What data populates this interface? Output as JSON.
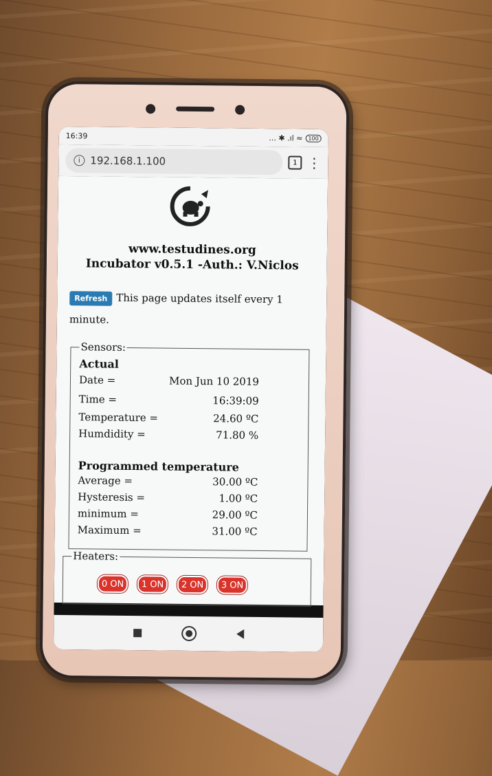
{
  "status_bar": {
    "time": "16:39",
    "signal": "... ✱ .ıl ≈",
    "battery": "100"
  },
  "browser": {
    "url": "192.168.1.100",
    "tab_count": "1",
    "menu_icon": "more-vert-icon"
  },
  "header": {
    "site": "www.testudines.org",
    "subtitle": "Incubator v0.5.1 -Auth.: V.Niclos"
  },
  "refresh": {
    "button_label": "Refresh",
    "note": "This page updates itself every 1 minute."
  },
  "sensors": {
    "legend": "Sensors:",
    "actual_heading": "Actual",
    "actual": [
      {
        "label": "Date =",
        "value": "Mon Jun 10 2019"
      },
      {
        "label": "Time =",
        "value": "16:39:09"
      },
      {
        "label": "Temperature =",
        "value": "24.60 ºC"
      },
      {
        "label": "Humdidity =",
        "value": "71.80 %"
      }
    ],
    "programmed_heading": "Programmed temperature",
    "programmed": [
      {
        "label": "Average =",
        "value": "30.00 ºC"
      },
      {
        "label": "Hysteresis =",
        "value": "1.00 ºC"
      },
      {
        "label": "minimum =",
        "value": "29.00 ºC"
      },
      {
        "label": "Maximum =",
        "value": "31.00 ºC"
      }
    ]
  },
  "heaters": {
    "legend": "Heaters:",
    "buttons": [
      "0 ON",
      "1 ON",
      "2 ON",
      "3 ON"
    ],
    "button_color": "#d9332b"
  },
  "colors": {
    "refresh_button": "#2b7bb3",
    "page_bg": "#f7f8f8"
  }
}
